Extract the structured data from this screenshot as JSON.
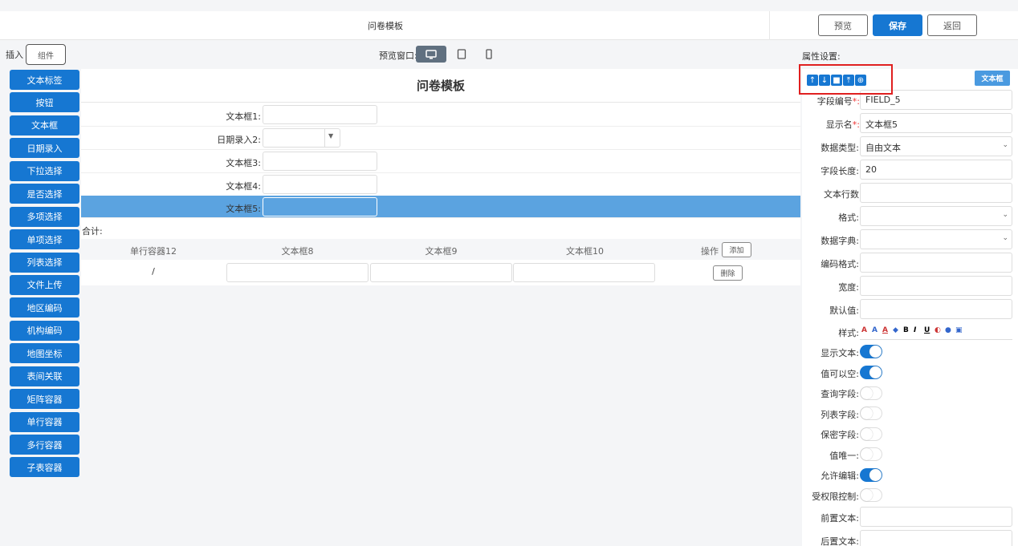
{
  "header": {
    "title": "问卷模板",
    "preview": "预览",
    "save": "保存",
    "back": "返回"
  },
  "toolbar": {
    "insert": "插入",
    "component": "组件",
    "preview_window": "预览窗口:"
  },
  "palette": [
    "文本标签",
    "按钮",
    "文本框",
    "日期录入",
    "下拉选择",
    "是否选择",
    "多项选择",
    "单项选择",
    "列表选择",
    "文件上传",
    "地区编码",
    "机构编码",
    "地图坐标",
    "表间关联",
    "矩阵容器",
    "单行容器",
    "多行容器",
    "子表容器"
  ],
  "form": {
    "title": "问卷模板",
    "rows": [
      {
        "label": "文本框1:"
      },
      {
        "label": "日期录入2:"
      },
      {
        "label": "文本框3:"
      },
      {
        "label": "文本框4:"
      },
      {
        "label": "文本框5:"
      }
    ],
    "sum": "合计:",
    "table": {
      "headers": [
        "单行容器12",
        "文本框8",
        "文本框9",
        "文本框10",
        "操作"
      ],
      "add": "添加",
      "row_first": "/",
      "delete": "删除"
    }
  },
  "props": {
    "title": "属性设置:",
    "tag": "文本框",
    "field_code_label": "字段编号",
    "field_code": "FIELD_5",
    "display_name_label": "显示名",
    "display_name": "文本框5",
    "data_type_label": "数据类型:",
    "data_type": "自由文本",
    "length_label": "字段长度:",
    "length": "20",
    "rows_label": "文本行数",
    "format_label": "格式:",
    "dict_label": "数据字典:",
    "code_format_label": "编码格式:",
    "width_label": "宽度:",
    "default_label": "默认值:",
    "style_label": "样式:",
    "toggles": [
      {
        "label": "显示文本:",
        "on": true
      },
      {
        "label": "值可以空:",
        "on": true
      },
      {
        "label": "查询字段:",
        "on": false
      },
      {
        "label": "列表字段:",
        "on": false
      },
      {
        "label": "保密字段:",
        "on": false
      },
      {
        "label": "值唯一:",
        "on": false
      },
      {
        "label": "允许编辑:",
        "on": true
      },
      {
        "label": "受权限控制:",
        "on": false
      }
    ],
    "prefix_label": "前置文本:",
    "suffix_label": "后置文本:"
  }
}
